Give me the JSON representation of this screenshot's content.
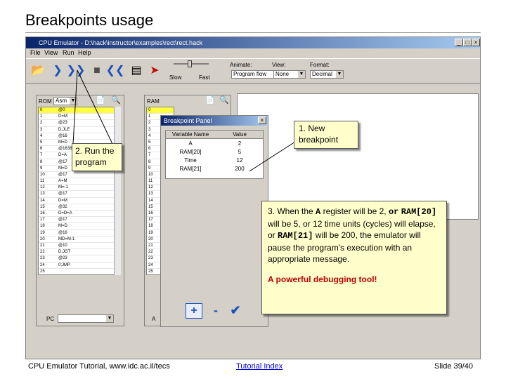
{
  "slide": {
    "title": "Breakpoints usage",
    "footer_left": "CPU Emulator Tutorial, www.idc.ac.il/tecs",
    "footer_center": "Tutorial Index",
    "footer_right": "Slide 39/40"
  },
  "window": {
    "title": "CPU Emulator - D:\\hack\\instructor\\examples\\rect\\rect.hack",
    "menu": [
      "File",
      "View",
      "Run",
      "Help"
    ]
  },
  "toolbar": {
    "slow_label": "Slow",
    "fast_label": "Fast",
    "animate_label": "Animate:",
    "animate_value": "Program flow",
    "view_label": "View:",
    "view_value": "None",
    "format_label": "Format:",
    "format_value": "Decimal"
  },
  "rom": {
    "label": "ROM",
    "mode": "Asm",
    "rows": [
      {
        "addr": "0",
        "val": "@0"
      },
      {
        "addr": "1",
        "val": "D=M"
      },
      {
        "addr": "2",
        "val": "@23"
      },
      {
        "addr": "3",
        "val": "D;JLE"
      },
      {
        "addr": "4",
        "val": "@16"
      },
      {
        "addr": "5",
        "val": "M=D"
      },
      {
        "addr": "6",
        "val": "@16384"
      },
      {
        "addr": "7",
        "val": "D=A"
      },
      {
        "addr": "8",
        "val": "@17"
      },
      {
        "addr": "9",
        "val": "M=D"
      },
      {
        "addr": "10",
        "val": "@17"
      },
      {
        "addr": "11",
        "val": "A=M"
      },
      {
        "addr": "12",
        "val": "M=-1"
      },
      {
        "addr": "13",
        "val": "@17"
      },
      {
        "addr": "14",
        "val": "D=M"
      },
      {
        "addr": "15",
        "val": "@32"
      },
      {
        "addr": "16",
        "val": "D=D+A"
      },
      {
        "addr": "17",
        "val": "@17"
      },
      {
        "addr": "18",
        "val": "M=D"
      },
      {
        "addr": "19",
        "val": "@16"
      },
      {
        "addr": "20",
        "val": "MD=M-1"
      },
      {
        "addr": "21",
        "val": "@10"
      },
      {
        "addr": "22",
        "val": "D;JGT"
      },
      {
        "addr": "23",
        "val": "@23"
      },
      {
        "addr": "24",
        "val": "0;JMP"
      },
      {
        "addr": "25",
        "val": ""
      },
      {
        "addr": "26",
        "val": ""
      },
      {
        "addr": "27",
        "val": ""
      },
      {
        "addr": "28",
        "val": ""
      }
    ],
    "pc_label": "PC"
  },
  "ram": {
    "label": "RAM",
    "rows": [
      "0",
      "1",
      "2",
      "3",
      "4",
      "5",
      "6",
      "7",
      "8",
      "9",
      "10",
      "11",
      "12",
      "13",
      "14",
      "15",
      "16",
      "17",
      "18",
      "19",
      "20",
      "21",
      "22",
      "23",
      "24",
      "25",
      "26",
      "27",
      "28"
    ],
    "a_label": "A"
  },
  "breakpoint_panel": {
    "title": "Breakpoint Panel",
    "col_name": "Variable Name",
    "col_value": "Value",
    "rows": [
      {
        "name": "A",
        "value": "2"
      },
      {
        "name": "RAM[20]",
        "value": "5"
      },
      {
        "name": "Time",
        "value": "12"
      },
      {
        "name": "RAM[21]",
        "value": "200"
      }
    ],
    "add_symbol": "+",
    "remove_symbol": "-",
    "ok_symbol": "✔"
  },
  "callouts": {
    "run_text": "2. Run the program",
    "new_text": "1. New breakpoint",
    "desc_1": "3. When the ",
    "desc_A": "A",
    "desc_2": " register will be 2, ",
    "desc_or": "or",
    "desc_ram20": "RAM[20]",
    "desc_3": " will be 5, or 12 time units (cycles) will elapse, or ",
    "desc_ram21": "RAM[21]",
    "desc_4": " will be 200, the emulator will pause the program's execution with an appropriate message.",
    "emphasis": "A powerful debugging tool!"
  },
  "colors": {
    "callout_bg": "#ffffcc",
    "highlight_row": "#ffff40",
    "titlebar": "#0a246a"
  }
}
